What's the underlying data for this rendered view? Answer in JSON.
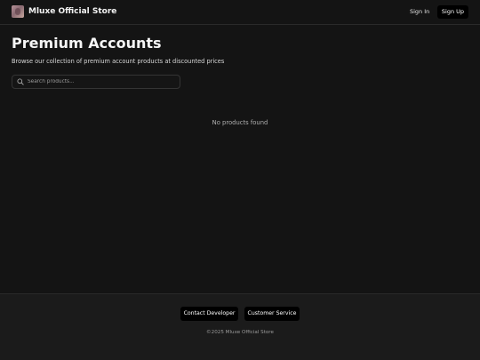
{
  "header": {
    "brand_name": "Mluxe Official Store",
    "sign_in_label": "Sign In",
    "sign_up_label": "Sign Up"
  },
  "main": {
    "title": "Premium Accounts",
    "subtitle": "Browse our collection of premium account products at discounted prices",
    "search": {
      "placeholder": "Search products...",
      "value": "",
      "icon": "search-icon"
    },
    "empty_message": "No products found"
  },
  "footer": {
    "contact_developer_label": "Contact Developer",
    "customer_service_label": "Customer Service",
    "copyright": "©2025 Mluxe Official Store"
  },
  "colors": {
    "background": "#141414",
    "footer_background": "#1b1b1b",
    "button_background": "#000000",
    "text_primary": "#f5f5f5",
    "text_muted": "#b0b0b0"
  }
}
